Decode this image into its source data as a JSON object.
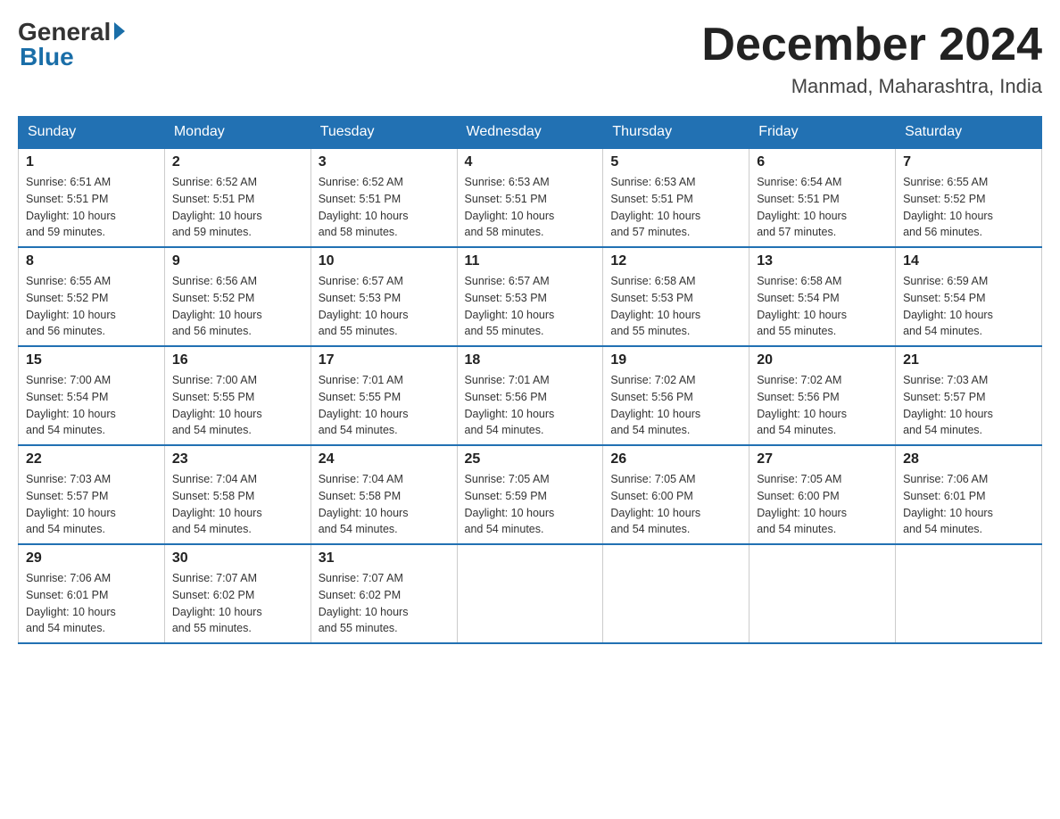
{
  "header": {
    "logo_general": "General",
    "logo_blue": "Blue",
    "month_title": "December 2024",
    "location": "Manmad, Maharashtra, India"
  },
  "weekdays": [
    "Sunday",
    "Monday",
    "Tuesday",
    "Wednesday",
    "Thursday",
    "Friday",
    "Saturday"
  ],
  "weeks": [
    [
      {
        "day": "1",
        "sunrise": "6:51 AM",
        "sunset": "5:51 PM",
        "daylight": "10 hours and 59 minutes."
      },
      {
        "day": "2",
        "sunrise": "6:52 AM",
        "sunset": "5:51 PM",
        "daylight": "10 hours and 59 minutes."
      },
      {
        "day": "3",
        "sunrise": "6:52 AM",
        "sunset": "5:51 PM",
        "daylight": "10 hours and 58 minutes."
      },
      {
        "day": "4",
        "sunrise": "6:53 AM",
        "sunset": "5:51 PM",
        "daylight": "10 hours and 58 minutes."
      },
      {
        "day": "5",
        "sunrise": "6:53 AM",
        "sunset": "5:51 PM",
        "daylight": "10 hours and 57 minutes."
      },
      {
        "day": "6",
        "sunrise": "6:54 AM",
        "sunset": "5:51 PM",
        "daylight": "10 hours and 57 minutes."
      },
      {
        "day": "7",
        "sunrise": "6:55 AM",
        "sunset": "5:52 PM",
        "daylight": "10 hours and 56 minutes."
      }
    ],
    [
      {
        "day": "8",
        "sunrise": "6:55 AM",
        "sunset": "5:52 PM",
        "daylight": "10 hours and 56 minutes."
      },
      {
        "day": "9",
        "sunrise": "6:56 AM",
        "sunset": "5:52 PM",
        "daylight": "10 hours and 56 minutes."
      },
      {
        "day": "10",
        "sunrise": "6:57 AM",
        "sunset": "5:53 PM",
        "daylight": "10 hours and 55 minutes."
      },
      {
        "day": "11",
        "sunrise": "6:57 AM",
        "sunset": "5:53 PM",
        "daylight": "10 hours and 55 minutes."
      },
      {
        "day": "12",
        "sunrise": "6:58 AM",
        "sunset": "5:53 PM",
        "daylight": "10 hours and 55 minutes."
      },
      {
        "day": "13",
        "sunrise": "6:58 AM",
        "sunset": "5:54 PM",
        "daylight": "10 hours and 55 minutes."
      },
      {
        "day": "14",
        "sunrise": "6:59 AM",
        "sunset": "5:54 PM",
        "daylight": "10 hours and 54 minutes."
      }
    ],
    [
      {
        "day": "15",
        "sunrise": "7:00 AM",
        "sunset": "5:54 PM",
        "daylight": "10 hours and 54 minutes."
      },
      {
        "day": "16",
        "sunrise": "7:00 AM",
        "sunset": "5:55 PM",
        "daylight": "10 hours and 54 minutes."
      },
      {
        "day": "17",
        "sunrise": "7:01 AM",
        "sunset": "5:55 PM",
        "daylight": "10 hours and 54 minutes."
      },
      {
        "day": "18",
        "sunrise": "7:01 AM",
        "sunset": "5:56 PM",
        "daylight": "10 hours and 54 minutes."
      },
      {
        "day": "19",
        "sunrise": "7:02 AM",
        "sunset": "5:56 PM",
        "daylight": "10 hours and 54 minutes."
      },
      {
        "day": "20",
        "sunrise": "7:02 AM",
        "sunset": "5:56 PM",
        "daylight": "10 hours and 54 minutes."
      },
      {
        "day": "21",
        "sunrise": "7:03 AM",
        "sunset": "5:57 PM",
        "daylight": "10 hours and 54 minutes."
      }
    ],
    [
      {
        "day": "22",
        "sunrise": "7:03 AM",
        "sunset": "5:57 PM",
        "daylight": "10 hours and 54 minutes."
      },
      {
        "day": "23",
        "sunrise": "7:04 AM",
        "sunset": "5:58 PM",
        "daylight": "10 hours and 54 minutes."
      },
      {
        "day": "24",
        "sunrise": "7:04 AM",
        "sunset": "5:58 PM",
        "daylight": "10 hours and 54 minutes."
      },
      {
        "day": "25",
        "sunrise": "7:05 AM",
        "sunset": "5:59 PM",
        "daylight": "10 hours and 54 minutes."
      },
      {
        "day": "26",
        "sunrise": "7:05 AM",
        "sunset": "6:00 PM",
        "daylight": "10 hours and 54 minutes."
      },
      {
        "day": "27",
        "sunrise": "7:05 AM",
        "sunset": "6:00 PM",
        "daylight": "10 hours and 54 minutes."
      },
      {
        "day": "28",
        "sunrise": "7:06 AM",
        "sunset": "6:01 PM",
        "daylight": "10 hours and 54 minutes."
      }
    ],
    [
      {
        "day": "29",
        "sunrise": "7:06 AM",
        "sunset": "6:01 PM",
        "daylight": "10 hours and 54 minutes."
      },
      {
        "day": "30",
        "sunrise": "7:07 AM",
        "sunset": "6:02 PM",
        "daylight": "10 hours and 55 minutes."
      },
      {
        "day": "31",
        "sunrise": "7:07 AM",
        "sunset": "6:02 PM",
        "daylight": "10 hours and 55 minutes."
      },
      null,
      null,
      null,
      null
    ]
  ],
  "labels": {
    "sunrise": "Sunrise:",
    "sunset": "Sunset:",
    "daylight": "Daylight:"
  }
}
